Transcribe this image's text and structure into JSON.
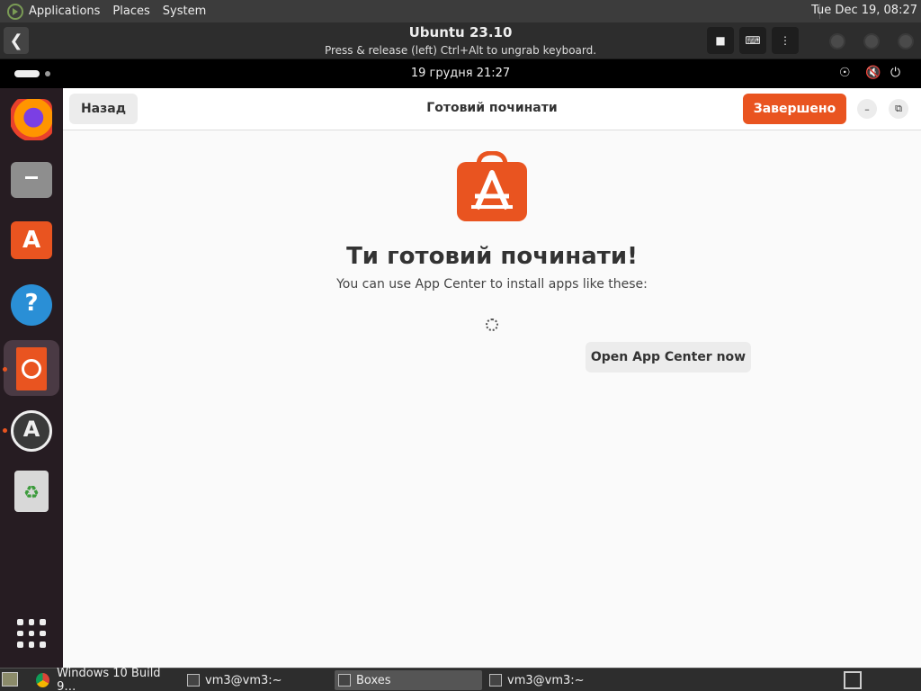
{
  "host_panel": {
    "menus": [
      "Applications",
      "Places",
      "System"
    ],
    "clock": "Tue Dec 19, 08:27"
  },
  "boxes_header": {
    "title": "Ubuntu 23.10",
    "subtitle": "Press & release (left) Ctrl+Alt to ungrab keyboard."
  },
  "guest_topbar": {
    "clock": "19 грудня  21:27"
  },
  "window": {
    "back_label": "Назад",
    "title": "Готовий починати",
    "done_label": "Завершено",
    "heading": "Ти готовий починати!",
    "subtext": "You can use App Center to install apps like these:",
    "open_button": "Open App Center now"
  },
  "taskbar": {
    "tasks": [
      "Windows 10 Build 9…",
      "vm3@vm3:~",
      "Boxes",
      "vm3@vm3:~"
    ]
  },
  "colors": {
    "accent": "#E95420",
    "dock_bg": "#261C22"
  }
}
